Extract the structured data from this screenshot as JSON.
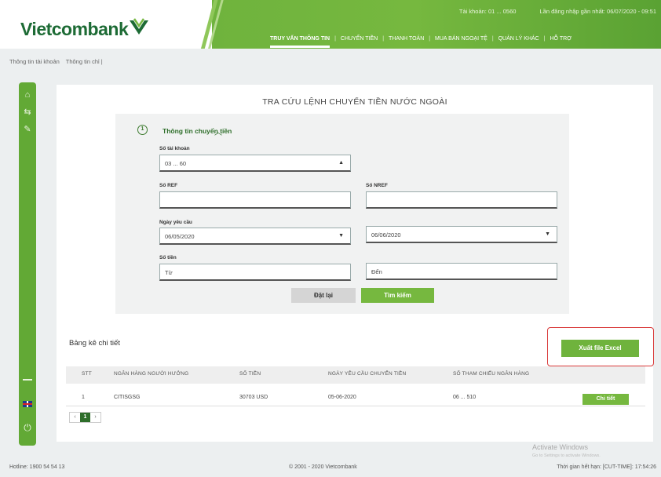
{
  "header": {
    "brand": "Vietcombank",
    "account_info": "Tài khoản: 01 ... 0560",
    "last_login": "Lần đăng nhập gần nhất: 06/07/2020 - 09:51",
    "nav": [
      "TRUY VẤN THÔNG TIN",
      "CHUYỂN TIỀN",
      "THANH TOÁN",
      "MUA BÁN NGOẠI TỆ",
      "QUẢN LÝ KHÁC",
      "HỖ TRỢ"
    ]
  },
  "breadcrumb": [
    "Thông tin tài khoản",
    "Thông tin chỉ |"
  ],
  "page_title": "TRA CỨU LỆNH CHUYỂN TIỀN NƯỚC NGOÀI",
  "form": {
    "section_title": "Thông tin chuyển tiền",
    "account_label": "Số tài khoản",
    "account_value": "03 ... 60",
    "ref_label": "Số REF",
    "ref_value": "",
    "nref_label": "Số NREF",
    "nref_value": "",
    "date_label": "Ngày yêu cầu",
    "date_from": "06/05/2020",
    "date_to": "06/06/2020",
    "amount_label": "Số tiền",
    "amount_from": "Từ",
    "amount_to": "Đến",
    "reset_label": "Đặt lại",
    "search_label": "Tìm kiếm"
  },
  "table": {
    "title": "Bảng kê chi tiết",
    "export_label": "Xuất file Excel",
    "headers": [
      "STT",
      "NGÂN HÀNG NGƯỜI HƯỞNG",
      "SỐ TIỀN",
      "NGÀY YÊU CẦU CHUYỂN TIỀN",
      "SỐ THAM CHIẾU NGÂN HÀNG"
    ],
    "rows": [
      {
        "stt": "1",
        "bank": "CITISGSG",
        "amount": "30703 USD",
        "date": "05-06-2020",
        "ref": "06 ... 510",
        "action": "Chi tiết"
      }
    ]
  },
  "pager": {
    "prev": "‹",
    "current": "1",
    "next": "›"
  },
  "footer": {
    "hotline": "Hotline: 1900 54 54 13",
    "copyright": "© 2001 - 2020 Vietcombank",
    "session": "Thời gian hết hạn: [CUT-TIME]: 17:54:26",
    "watermark": "Activate Windows",
    "watermark_sub": "Go to Settings to activate Windows."
  }
}
